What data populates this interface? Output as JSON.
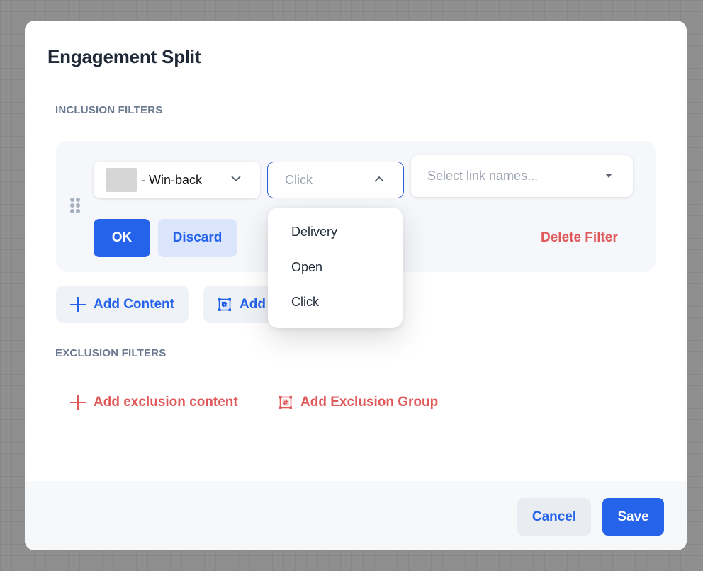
{
  "modal": {
    "title": "Engagement Split"
  },
  "inclusion": {
    "label": "INCLUSION FILTERS",
    "filter": {
      "content_select": {
        "value": "- Win-back"
      },
      "action_select": {
        "value": "Click"
      },
      "links_select": {
        "placeholder": "Select link names..."
      },
      "ok_label": "OK",
      "discard_label": "Discard",
      "delete_label": "Delete Filter"
    },
    "add_content_label": "Add Content",
    "add_group_label": "Add"
  },
  "exclusion": {
    "label": "EXCLUSION FILTERS",
    "add_content_label": "Add exclusion content",
    "add_group_label": "Add Exclusion Group"
  },
  "dropdown": {
    "options": [
      "Delivery",
      "Open",
      "Click"
    ]
  },
  "footer": {
    "cancel_label": "Cancel",
    "save_label": "Save"
  },
  "colors": {
    "primary": "#2563eb",
    "danger": "#e0595a",
    "muted_label": "#6b7a8f"
  }
}
